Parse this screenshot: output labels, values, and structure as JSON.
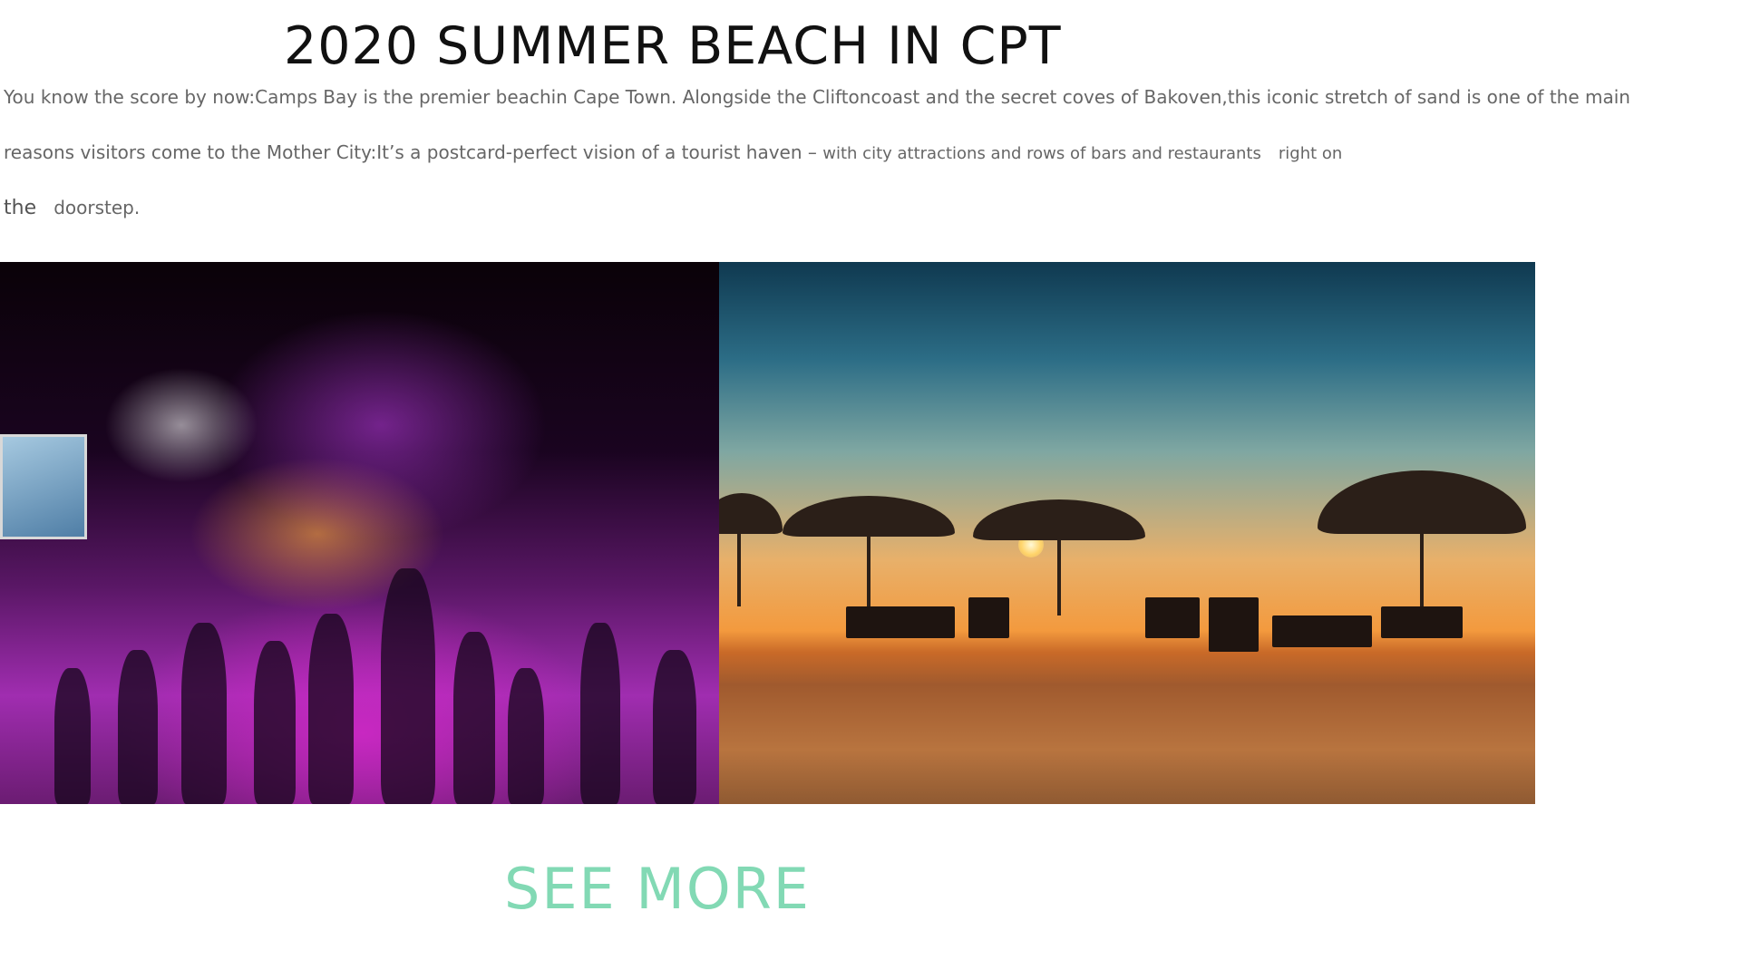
{
  "page": {
    "title": "2020 SUMMER BEACH IN CPT",
    "paragraph": {
      "line1": "You know the score by now:Camps Bay is the premier beachin Cape Town. Alongside the Cliftoncoast and the secret coves of Bakoven,this iconic stretch of sand is one of the main",
      "line2_a": "reasons visitors come to the Mother City:It’s a postcard-perfect vision of a tourist haven – ",
      "line2_b": "with city attractions and rows of bars and restaurants",
      "line2_c": "right on",
      "line3_a": "the",
      "line3_b": "doorstep."
    },
    "see_more_label": "SEE MORE"
  },
  "images": [
    {
      "name": "beach-party-photo",
      "subject": "night beach party with purple lights and dancers"
    },
    {
      "name": "sunset-beach-photo",
      "subject": "sunset beach with straw umbrellas and loungers"
    }
  ],
  "colors": {
    "title": "#111111",
    "paragraph": "#666666",
    "see_more": "#82d9b4",
    "background": "#ffffff"
  }
}
